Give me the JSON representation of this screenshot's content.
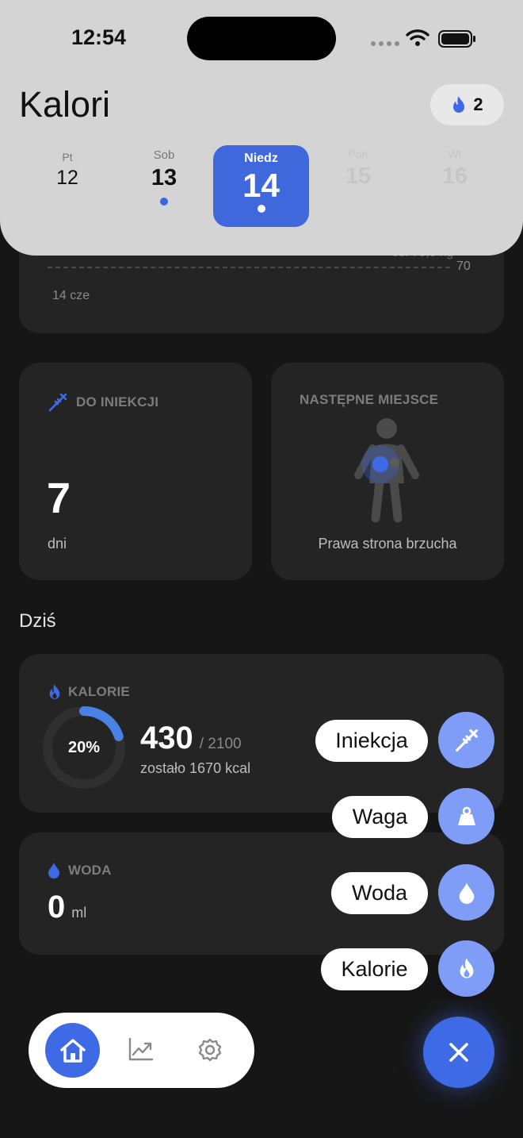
{
  "status_bar": {
    "time": "12:54"
  },
  "header": {
    "title": "Kalori",
    "streak_count": "2",
    "days": [
      {
        "name": "Pt",
        "num": "12",
        "has_dot": false,
        "state": "normal"
      },
      {
        "name": "Sob",
        "num": "13",
        "has_dot": true,
        "state": "normal"
      },
      {
        "name": "Niedz",
        "num": "14",
        "has_dot": true,
        "state": "selected"
      },
      {
        "name": "Pon",
        "num": "15",
        "has_dot": false,
        "state": "faded"
      },
      {
        "name": "Wt",
        "num": "16",
        "has_dot": false,
        "state": "faded"
      }
    ]
  },
  "weight_card": {
    "goal_text": "cel 70,0 kg",
    "goal_value": "70",
    "date_label": "14 cze"
  },
  "injection_card": {
    "label": "DO INIEKCJI",
    "value": "7",
    "unit": "dni"
  },
  "site_card": {
    "label": "NASTĘPNE MIEJSCE",
    "site": "Prawa strona brzucha"
  },
  "section_today": "Dziś",
  "calories_card": {
    "label": "KALORIE",
    "percent_text": "20%",
    "progress": 0.2,
    "value": "430",
    "goal": "/ 2100",
    "remaining": "zostało 1670 kcal"
  },
  "water_card": {
    "label": "WODA",
    "value": "0",
    "unit": "ml"
  },
  "fab_menu": {
    "items": [
      {
        "label": "Iniekcja",
        "icon": "syringe-icon"
      },
      {
        "label": "Waga",
        "icon": "weight-icon"
      },
      {
        "label": "Woda",
        "icon": "water-drop-icon"
      },
      {
        "label": "Kalorie",
        "icon": "flame-icon"
      }
    ],
    "close_icon": "close-icon"
  },
  "bottom_nav": {
    "items": [
      {
        "icon": "home-icon",
        "active": true
      },
      {
        "icon": "chart-icon",
        "active": false
      },
      {
        "icon": "gear-icon",
        "active": false
      }
    ]
  },
  "colors": {
    "accent": "#3f6ae6",
    "accent_light": "#7f9cf6",
    "background": "#161616",
    "card": "#242424",
    "header": "#d4d4d4"
  }
}
